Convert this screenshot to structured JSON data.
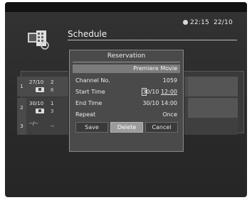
{
  "status": {
    "time": "22:15",
    "date": "22/10"
  },
  "header": {
    "title": "Schedule",
    "logo": "tv-calendar-icon"
  },
  "rows": [
    {
      "number": "1",
      "date": "27/10",
      "time": "2",
      "channel": "6",
      "icon": "tv-icon"
    },
    {
      "number": "2",
      "date": "30/10",
      "time": "1",
      "channel": "3",
      "icon": "tv-icon"
    },
    {
      "number": "3",
      "date": "--/--",
      "time": "--"
    }
  ],
  "dialog": {
    "title": "Reservation",
    "program": "Premiere Movie",
    "fields": {
      "channel": {
        "label": "Channel No.",
        "value": "1059"
      },
      "start": {
        "label": "Start Time",
        "date_a": "3",
        "date_b": "0",
        "date_c": "/10 ",
        "time": "12:00"
      },
      "end": {
        "label": "End Time",
        "value": "30/10 14:00"
      },
      "repeat": {
        "label": "Repeat",
        "value": "Once"
      }
    },
    "buttons": {
      "save": "Save",
      "delete": "Delete",
      "cancel": "Cancel"
    }
  }
}
